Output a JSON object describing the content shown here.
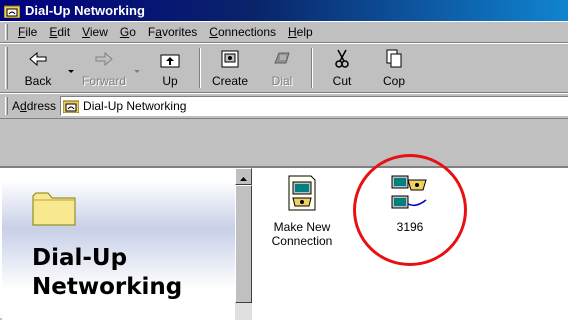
{
  "window": {
    "title": "Dial-Up Networking"
  },
  "menu": [
    "File",
    "Edit",
    "View",
    "Go",
    "Favorites",
    "Connections",
    "Help"
  ],
  "menu_access_keys": [
    "F",
    "E",
    "V",
    "G",
    "a",
    "C",
    "H"
  ],
  "toolbar": {
    "back": "Back",
    "forward": "Forward",
    "up": "Up",
    "create": "Create",
    "dial": "Dial",
    "cut": "Cut",
    "copy": "Cop"
  },
  "address": {
    "label": "Address",
    "value": "Dial-Up Networking"
  },
  "left_pane": {
    "title_line1": "Dial-Up",
    "title_line2": "Networking"
  },
  "icons": [
    {
      "label_line1": "Make New",
      "label_line2": "Connection"
    },
    {
      "label_line1": "3196",
      "label_line2": ""
    }
  ],
  "colors": {
    "titlebar": "#000080",
    "highlight_circle": "#e81010",
    "face": "#c0c0c0"
  }
}
